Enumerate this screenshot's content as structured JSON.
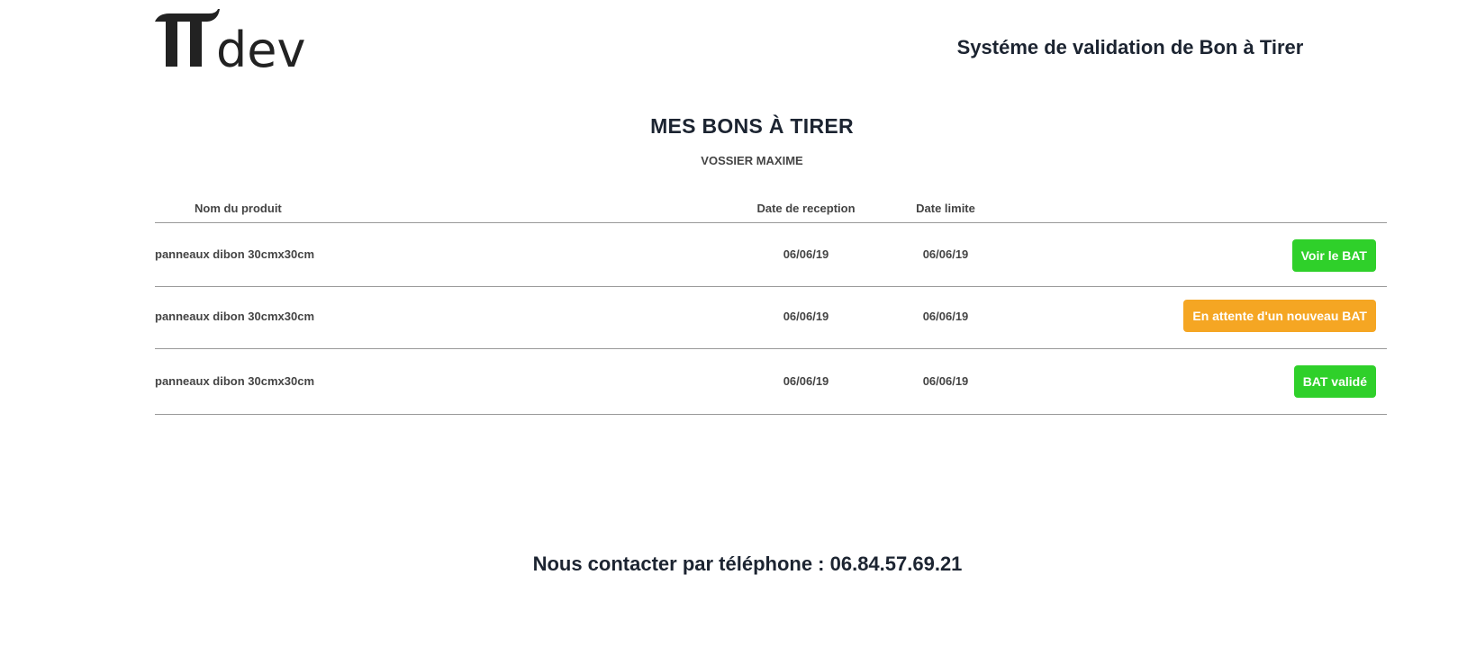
{
  "header": {
    "logo_text": "dev",
    "title": "Systéme de validation de Bon à Tirer"
  },
  "page": {
    "title": "MES BONS À TIRER",
    "client": "VOSSIER MAXIME"
  },
  "table": {
    "columns": {
      "name": "Nom du produit",
      "reception": "Date de reception",
      "limit": "Date limite"
    },
    "rows": [
      {
        "name": "panneaux dibon 30cmx30cm",
        "reception": "06/06/19",
        "limit": "06/06/19",
        "action": "Voir le BAT",
        "action_color": "#2fd02a"
      },
      {
        "name": "panneaux dibon 30cmx30cm",
        "reception": "06/06/19",
        "limit": "06/06/19",
        "action": "En attente d'un nouveau BAT",
        "action_color": "#f5a623"
      },
      {
        "name": "panneaux dibon 30cmx30cm",
        "reception": "06/06/19",
        "limit": "06/06/19",
        "action": "BAT validé",
        "action_color": "#2fd02a"
      }
    ]
  },
  "footer": {
    "contact": "Nous contacter par téléphone : 06.84.57.69.21"
  }
}
